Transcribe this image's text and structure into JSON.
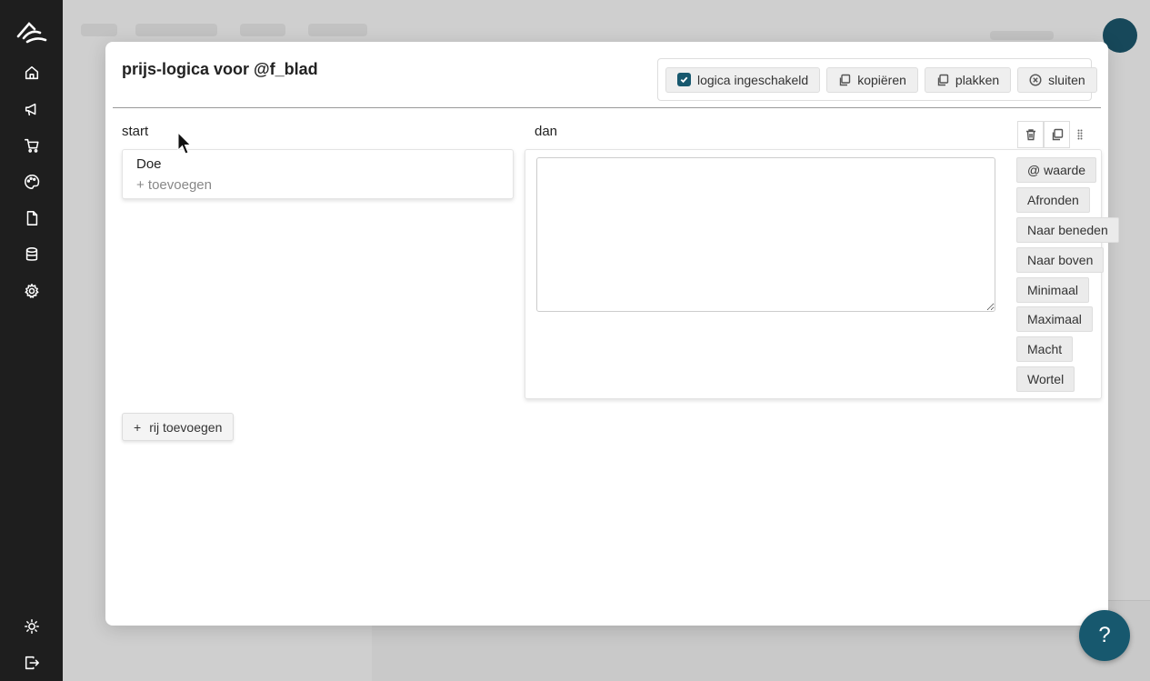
{
  "sidebar": {
    "items": [
      {
        "icon": "home-icon"
      },
      {
        "icon": "megaphone-icon"
      },
      {
        "icon": "cart-icon"
      },
      {
        "icon": "palette-icon"
      },
      {
        "icon": "document-icon"
      },
      {
        "icon": "database-icon"
      },
      {
        "icon": "gear-icon"
      }
    ],
    "bottom": [
      {
        "icon": "sun-icon"
      },
      {
        "icon": "logout-icon"
      }
    ]
  },
  "modal": {
    "title": "prijs-logica voor @f_blad",
    "toolbar": {
      "enabled_label": "logica ingeschakeld",
      "enabled_checked": true,
      "copy_label": "kopiëren",
      "paste_label": "plakken",
      "close_label": "sluiten"
    },
    "start": {
      "label": "start",
      "item": "Doe",
      "add_label": "+ toevoegen"
    },
    "dan": {
      "label": "dan",
      "textarea_value": "",
      "functions": [
        "@ waarde",
        "Afronden",
        "Naar beneden",
        "Naar boven",
        "Minimaal",
        "Maximaal",
        "Macht",
        "Wortel"
      ]
    },
    "add_row_label": "rij toevoegen"
  },
  "help": {
    "label": "?"
  },
  "colors": {
    "accent": "#17586e",
    "sidebar": "#1e1e1e"
  }
}
